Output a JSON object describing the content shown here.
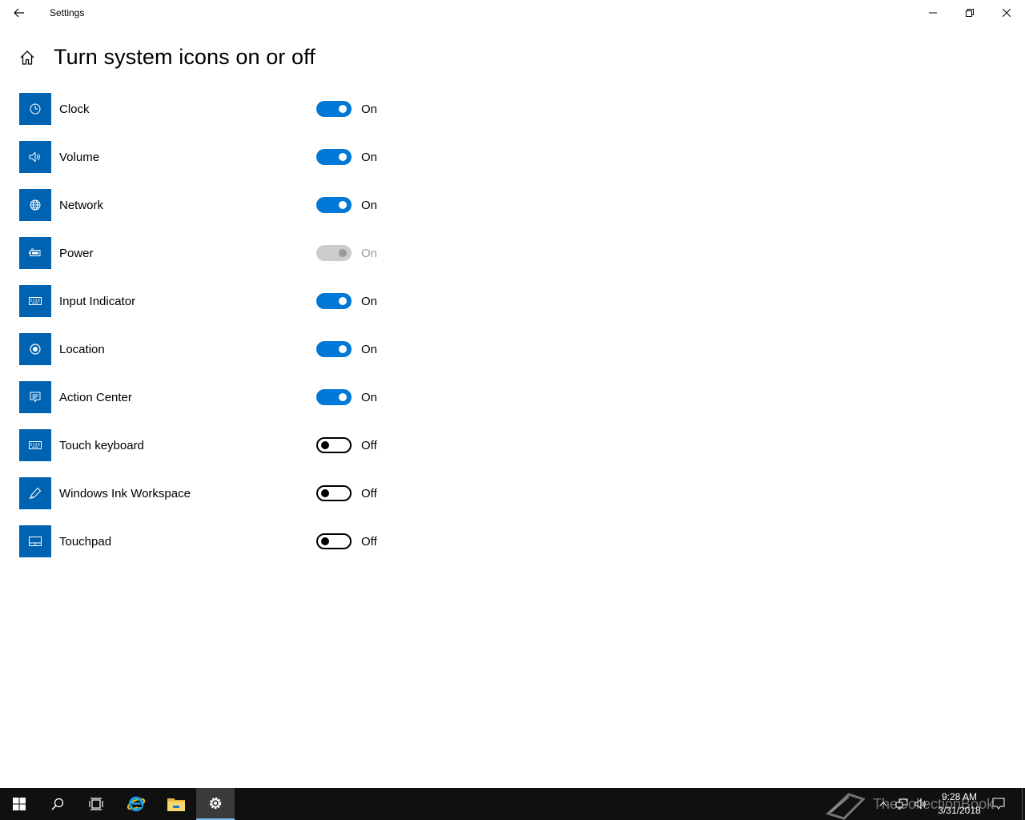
{
  "window": {
    "title": "Settings"
  },
  "header": {
    "title": "Turn system icons on or off"
  },
  "colors": {
    "accent": "#0078d7",
    "icon_tile": "#0063b1",
    "disabled": "#cccccc"
  },
  "items": [
    {
      "label": "Clock",
      "icon": "clock-icon",
      "state": "On",
      "toggle": "on"
    },
    {
      "label": "Volume",
      "icon": "volume-icon",
      "state": "On",
      "toggle": "on"
    },
    {
      "label": "Network",
      "icon": "network-icon",
      "state": "On",
      "toggle": "on"
    },
    {
      "label": "Power",
      "icon": "battery-icon",
      "state": "On",
      "toggle": "disabled"
    },
    {
      "label": "Input Indicator",
      "icon": "keyboard-icon",
      "state": "On",
      "toggle": "on"
    },
    {
      "label": "Location",
      "icon": "location-icon",
      "state": "On",
      "toggle": "on"
    },
    {
      "label": "Action Center",
      "icon": "action-center-icon",
      "state": "On",
      "toggle": "on"
    },
    {
      "label": "Touch keyboard",
      "icon": "keyboard-icon",
      "state": "Off",
      "toggle": "off"
    },
    {
      "label": "Windows Ink Workspace",
      "icon": "pen-icon",
      "state": "Off",
      "toggle": "off"
    },
    {
      "label": "Touchpad",
      "icon": "touchpad-icon",
      "state": "Off",
      "toggle": "off"
    }
  ],
  "taskbar": {
    "time": "9:28 AM",
    "date": "3/31/2018",
    "watermark": "TheCollectionBook"
  }
}
